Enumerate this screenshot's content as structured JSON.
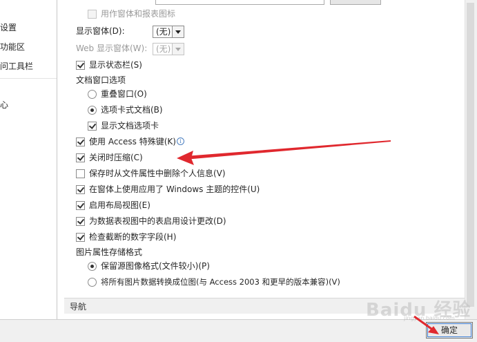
{
  "left_nav": {
    "items": [
      {
        "label": "设置"
      },
      {
        "label": "功能区"
      },
      {
        "label": "问工具栏"
      },
      {
        "label": "心"
      }
    ]
  },
  "options": {
    "app_icon_checkbox": {
      "label": "用作窗体和报表图标",
      "checked": false,
      "enabled": false
    },
    "display_form": {
      "label": "显示窗体(D):",
      "value": "(无)"
    },
    "web_display_form": {
      "label": "Web 显示窗体(W):",
      "value": "(无)"
    },
    "status_bar": {
      "label": "显示状态栏(S)",
      "checked": true
    },
    "doc_window_heading": "文档窗口选项",
    "overlapping_windows": {
      "label": "重叠窗口(O)",
      "selected": false
    },
    "tabbed_documents": {
      "label": "选项卡式文档(B)",
      "selected": true
    },
    "document_tabs": {
      "label": "显示文档选项卡",
      "checked": true
    },
    "access_special_keys": {
      "label": "使用 Access 特殊键(K)",
      "checked": true,
      "info_glyph": "i"
    },
    "compact_on_close": {
      "label": "关闭时压缩(C)",
      "checked": true
    },
    "remove_personal_info": {
      "label": "保存时从文件属性中删除个人信息(V)",
      "checked": false
    },
    "windows_themed_controls": {
      "label": "在窗体上使用应用了 Windows 主题的控件(U)",
      "checked": true
    },
    "layout_view": {
      "label": "启用布局视图(E)",
      "checked": true
    },
    "datasheet_design_changes": {
      "label": "为数据表视图中的表启用设计更改(D)",
      "checked": true
    },
    "truncated_number_fields": {
      "label": "检查截断的数字字段(H)",
      "checked": true
    },
    "picture_format_heading": "图片属性存储格式",
    "preserve_source_format": {
      "label": "保留源图像格式(文件较小)(P)",
      "selected": true
    },
    "convert_to_bitmap": {
      "label": "将所有图片数据转换成位图(与 Access 2003 和更早的版本兼容)(V)",
      "selected": false
    }
  },
  "section_header": {
    "label": "导航"
  },
  "footer": {
    "ok_label": "确定"
  },
  "watermark": {
    "text": "Baidu 经验",
    "sub": "jingyan.baidu.com"
  },
  "colors": {
    "annotation_arrow": "#e0282e",
    "focus_ring": "#3c7fd6"
  }
}
